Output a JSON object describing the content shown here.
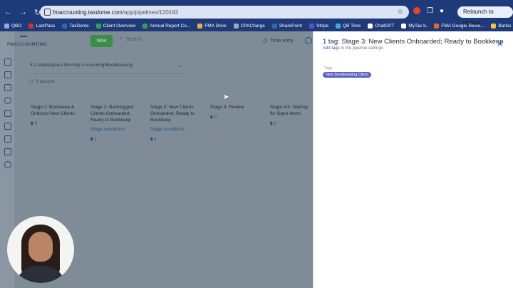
{
  "browser": {
    "url_domain": "fmaccounting.taxdome.com",
    "url_path": "/app/pipelines/120193",
    "relaunch_label": "Relaunch to update",
    "bookmarks": [
      "QBO",
      "LastPass",
      "TaxDome",
      "Client Overview",
      "Annual Report Co...",
      "FMA Drive",
      "CPACharge",
      "SharePoint",
      "Stripe",
      "QB Time",
      "ChatGPT",
      "MyTax IL",
      "FMA Google Revie...",
      "Banks"
    ],
    "bookmark_colors": [
      "#7fb0e8",
      "#d32f2f",
      "#2b6cb0",
      "#3c9d4f",
      "#3c9d4f",
      "#e0b34a",
      "#9aa8b8",
      "#2b6cb0",
      "#5b4ddb",
      "#4aa3e0",
      "#ffffff",
      "#ffffff",
      "#e06a2b",
      "#f0c33c"
    ]
  },
  "app": {
    "logo_text": "FMACCOUNTING",
    "new_label": "New",
    "search_placeholder": "Search",
    "time_entry_label": "Time entry",
    "pipeline_name": "5.3 Marketplace Monthly Accounting/Bookkeeping",
    "accounts_count": "9 account",
    "stages": [
      {
        "title": "Stage 1: Bookkeep & Onboard New Clients",
        "conditions": "",
        "count": "5"
      },
      {
        "title": "Stage 2: Backlogged Clients Onboarded; Ready to Bookkeep",
        "conditions": "Stage conditions",
        "count": "1"
      },
      {
        "title": "Stage 3: New Clients Onboarded; Ready to Bookkeep",
        "conditions": "Stage conditions",
        "count": "1"
      },
      {
        "title": "Stage 4: Review",
        "conditions": "",
        "count": "0"
      },
      {
        "title": "Stage 4.5: Waiting for Open Items",
        "conditions": "",
        "count": "2"
      }
    ]
  },
  "panel": {
    "title": "1 tag: Stage 3: New Clients Onboarded; Ready to Bookkeep",
    "sub_link": "Add tags",
    "sub_rest": "in the pipeline settings",
    "tags_label": "Tags",
    "tag": "New Bookkeeping Client"
  }
}
